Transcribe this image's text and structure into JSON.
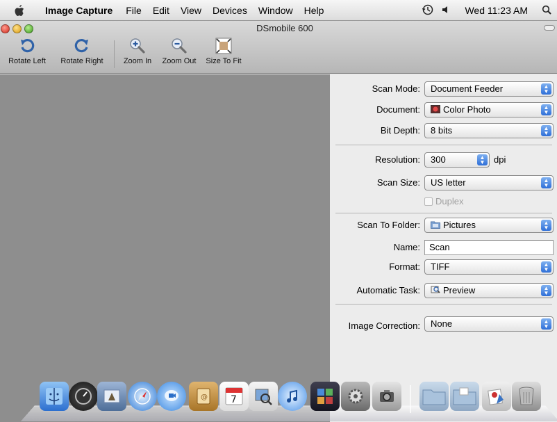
{
  "menubar": {
    "app_name": "Image Capture",
    "items": [
      "File",
      "Edit",
      "View",
      "Devices",
      "Window",
      "Help"
    ],
    "clock": "Wed 11:23 AM"
  },
  "window": {
    "title": "DSmobile 600"
  },
  "toolbar": {
    "rotate_left": "Rotate Left",
    "rotate_right": "Rotate Right",
    "zoom_in": "Zoom In",
    "zoom_out": "Zoom Out",
    "size_to_fit": "Size To Fit"
  },
  "settings": {
    "scan_mode": {
      "label": "Scan Mode:",
      "value": "Document Feeder"
    },
    "document": {
      "label": "Document:",
      "value": "Color Photo"
    },
    "bit_depth": {
      "label": "Bit Depth:",
      "value": "8 bits"
    },
    "resolution": {
      "label": "Resolution:",
      "value": "300",
      "unit": "dpi"
    },
    "scan_size": {
      "label": "Scan Size:",
      "value": "US letter"
    },
    "duplex": {
      "label": "Duplex",
      "checked": false,
      "enabled": false
    },
    "scan_to_folder": {
      "label": "Scan To Folder:",
      "value": "Pictures"
    },
    "name": {
      "label": "Name:",
      "value": "Scan"
    },
    "format": {
      "label": "Format:",
      "value": "TIFF"
    },
    "automatic_task": {
      "label": "Automatic Task:",
      "value": "Preview"
    },
    "image_correction": {
      "label": "Image Correction:",
      "value": "None"
    }
  },
  "dock": {
    "icons": [
      "finder-icon",
      "dashboard-icon",
      "mail-icon",
      "safari-icon",
      "ichat-icon",
      "address-book-icon",
      "ical-icon",
      "preview-icon",
      "itunes-icon",
      "spaces-icon",
      "system-preferences-icon",
      "image-capture-icon",
      "applications-folder-icon",
      "documents-folder-icon",
      "downloads-stack-icon",
      "trash-icon"
    ]
  }
}
